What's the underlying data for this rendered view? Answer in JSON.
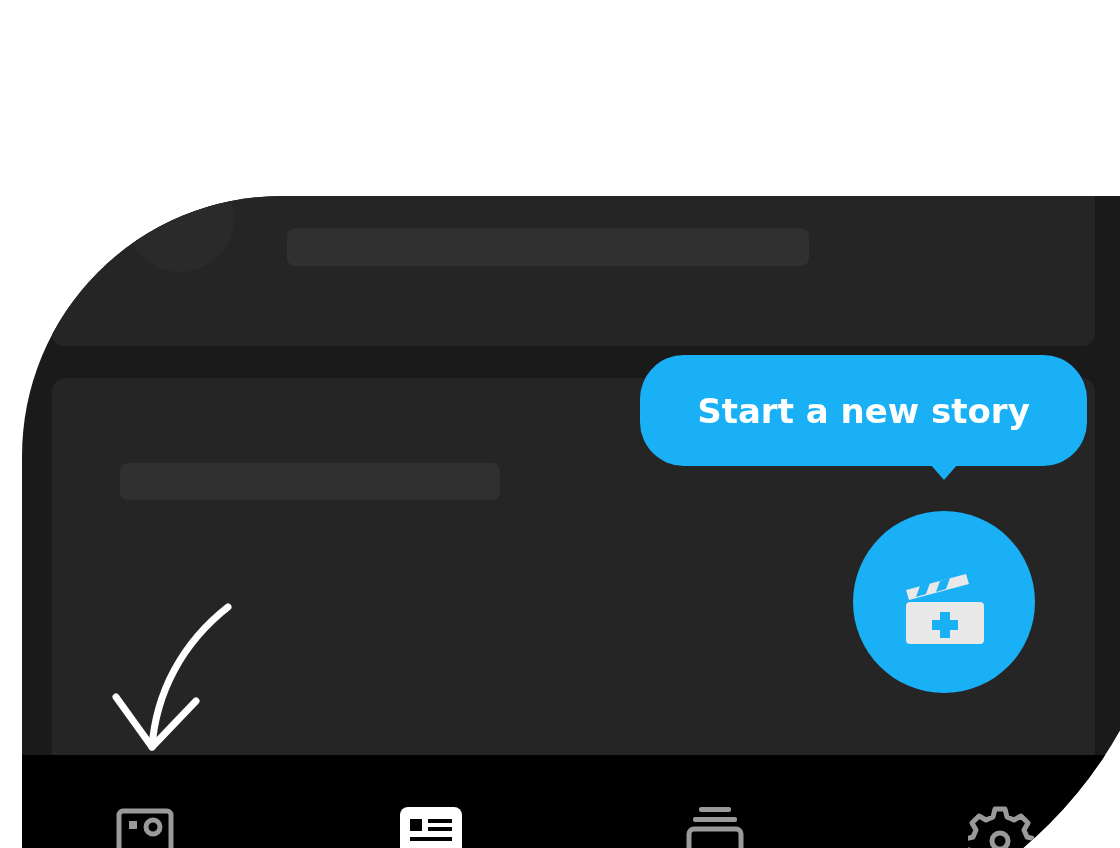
{
  "tooltip": {
    "text": "Start a new story"
  },
  "nav_tabs": [
    {
      "kind": "camera",
      "selected": false
    },
    {
      "kind": "feed",
      "selected": true
    },
    {
      "kind": "stack",
      "selected": false
    },
    {
      "kind": "settings",
      "selected": false
    }
  ]
}
